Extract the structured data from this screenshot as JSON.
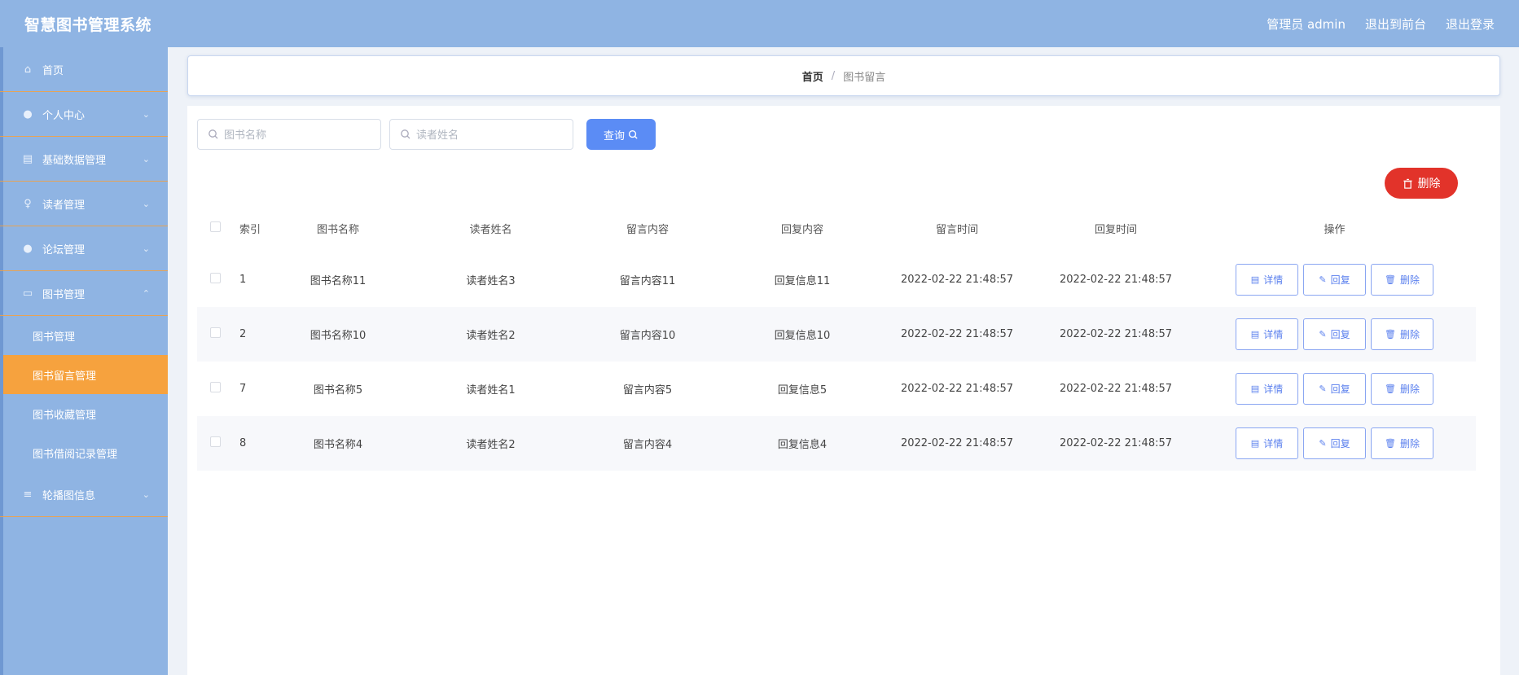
{
  "header": {
    "title": "智慧图书管理系统",
    "links": [
      "管理员 admin",
      "退出到前台",
      "退出登录"
    ]
  },
  "sidebar": {
    "items": [
      {
        "label": "首页",
        "icon": "home-icon"
      },
      {
        "label": "个人中心",
        "icon": "user-icon"
      },
      {
        "label": "基础数据管理",
        "icon": "grid-icon"
      },
      {
        "label": "读者管理",
        "icon": "pin-icon"
      },
      {
        "label": "论坛管理",
        "icon": "user-icon"
      },
      {
        "label": "图书管理",
        "icon": "screen-icon"
      },
      {
        "label": "轮播图信息",
        "icon": "menu-icon"
      }
    ],
    "subitems": [
      "图书管理",
      "图书留言管理",
      "图书收藏管理",
      "图书借阅记录管理"
    ]
  },
  "breadcrumb": {
    "home": "首页",
    "sep": "/",
    "current": "图书留言"
  },
  "search": {
    "book_placeholder": "图书名称",
    "reader_placeholder": "读者姓名",
    "query_label": "查询"
  },
  "delete_label": "删除",
  "table": {
    "headers": [
      "索引",
      "图书名称",
      "读者姓名",
      "留言内容",
      "回复内容",
      "留言时间",
      "回复时间",
      "操作"
    ],
    "rows": [
      {
        "idx": "1",
        "book": "图书名称11",
        "reader": "读者姓名3",
        "content": "留言内容11",
        "reply": "回复信息11",
        "msg_time": "2022-02-22 21:48:57",
        "reply_time": "2022-02-22 21:48:57"
      },
      {
        "idx": "2",
        "book": "图书名称10",
        "reader": "读者姓名2",
        "content": "留言内容10",
        "reply": "回复信息10",
        "msg_time": "2022-02-22 21:48:57",
        "reply_time": "2022-02-22 21:48:57"
      },
      {
        "idx": "7",
        "book": "图书名称5",
        "reader": "读者姓名1",
        "content": "留言内容5",
        "reply": "回复信息5",
        "msg_time": "2022-02-22 21:48:57",
        "reply_time": "2022-02-22 21:48:57"
      },
      {
        "idx": "8",
        "book": "图书名称4",
        "reader": "读者姓名2",
        "content": "留言内容4",
        "reply": "回复信息4",
        "msg_time": "2022-02-22 21:48:57",
        "reply_time": "2022-02-22 21:48:57"
      }
    ],
    "actions": {
      "detail": "详情",
      "reply": "回复",
      "delete": "删除"
    }
  }
}
